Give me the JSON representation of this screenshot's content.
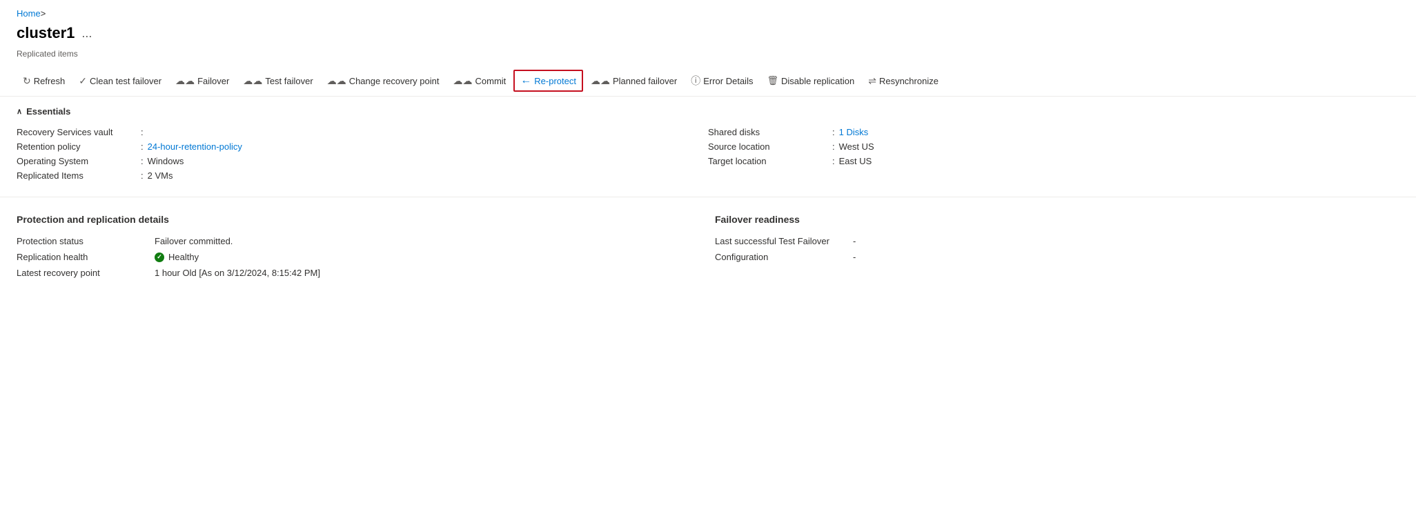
{
  "breadcrumb": {
    "home_label": "Home",
    "sep": ">"
  },
  "page": {
    "title": "cluster1",
    "ellipsis": "...",
    "subtitle": "Replicated items"
  },
  "toolbar": {
    "items": [
      {
        "id": "refresh",
        "icon": "refresh",
        "label": "Refresh",
        "highlighted": false
      },
      {
        "id": "clean-test-failover",
        "icon": "check",
        "label": "Clean test failover",
        "highlighted": false
      },
      {
        "id": "failover",
        "icon": "cloud",
        "label": "Failover",
        "highlighted": false
      },
      {
        "id": "test-failover",
        "icon": "cloud",
        "label": "Test failover",
        "highlighted": false
      },
      {
        "id": "change-recovery-point",
        "icon": "cloud",
        "label": "Change recovery point",
        "highlighted": false
      },
      {
        "id": "commit",
        "icon": "cloud",
        "label": "Commit",
        "highlighted": false
      },
      {
        "id": "re-protect",
        "icon": "arrow-left",
        "label": "Re-protect",
        "highlighted": true
      },
      {
        "id": "planned-failover",
        "icon": "cloud",
        "label": "Planned failover",
        "highlighted": false
      },
      {
        "id": "error-details",
        "icon": "info",
        "label": "Error Details",
        "highlighted": false
      },
      {
        "id": "disable-replication",
        "icon": "trash",
        "label": "Disable replication",
        "highlighted": false
      },
      {
        "id": "resynchronize",
        "icon": "arrows",
        "label": "Resynchronize",
        "highlighted": false
      }
    ]
  },
  "essentials": {
    "section_title": "Essentials",
    "left_rows": [
      {
        "label": "Recovery Services vault",
        "sep": ":",
        "value": "",
        "link": false
      },
      {
        "label": "Retention policy",
        "sep": ":",
        "value": "24-hour-retention-policy",
        "link": true
      },
      {
        "label": "Operating System",
        "sep": ":",
        "value": "Windows",
        "link": false
      },
      {
        "label": "Replicated Items",
        "sep": ":",
        "value": "2 VMs",
        "link": false
      }
    ],
    "right_rows": [
      {
        "label": "Shared disks",
        "sep": ":",
        "value": "1 Disks",
        "link": true
      },
      {
        "label": "Source location",
        "sep": ":",
        "value": "West US",
        "link": false
      },
      {
        "label": "Target location",
        "sep": ":",
        "value": "East US",
        "link": false
      }
    ]
  },
  "protection": {
    "heading": "Protection and replication details",
    "rows": [
      {
        "label": "Protection status",
        "value": "Failover committed.",
        "type": "text"
      },
      {
        "label": "Replication health",
        "value": "Healthy",
        "type": "healthy"
      },
      {
        "label": "Latest recovery point",
        "value": "1 hour Old [As on 3/12/2024, 8:15:42 PM]",
        "type": "text"
      }
    ]
  },
  "failover_readiness": {
    "heading": "Failover readiness",
    "rows": [
      {
        "label": "Last successful Test Failover",
        "value": "-"
      },
      {
        "label": "Configuration",
        "value": "-"
      }
    ]
  }
}
